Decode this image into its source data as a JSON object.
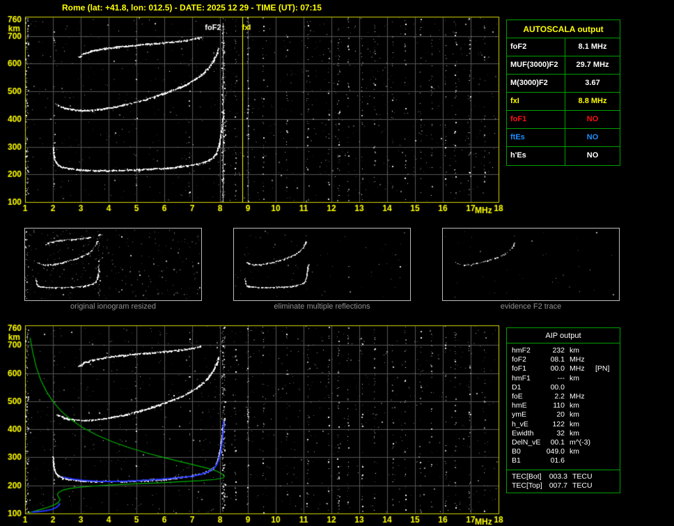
{
  "title": "Rome (lat: +41.8, lon: 012.5) - DATE: 2025 12 29 - TIME (UT): 07:15",
  "colors": {
    "background": "#000000",
    "axis_text": "#ffff00",
    "plot_border": "#d6d600",
    "grid": "#565656",
    "table_border": "#00a000",
    "fof2_marker": "#e8e8e8",
    "fxi_marker": "#ffff00",
    "profile_green": "#00b400",
    "profile_blue": "#2233ff",
    "caption_gray": "#919191",
    "red": "#ff1010",
    "blue": "#1e8fff",
    "yellow": "#ffff00",
    "white": "#ffffff"
  },
  "ionogram": {
    "type": "scatter",
    "x_range": [
      1,
      18
    ],
    "y_range": [
      100,
      770
    ],
    "x_ticks": [
      1,
      2,
      3,
      4,
      5,
      6,
      7,
      8,
      9,
      10,
      11,
      12,
      13,
      14,
      15,
      16,
      17,
      18
    ],
    "y_ticks": [
      760,
      700,
      600,
      500,
      400,
      300,
      200,
      100
    ],
    "x_unit": "MHz",
    "y_unit": "km"
  },
  "top_plot": {
    "foF2_label": "foF2",
    "fxI_label": "fxI",
    "foF2_freq": 8.1,
    "fxI_freq": 8.8
  },
  "traces": {
    "first_hop": [
      [
        2.0,
        302
      ],
      [
        2.02,
        278
      ],
      [
        2.05,
        258
      ],
      [
        2.1,
        244
      ],
      [
        2.2,
        233
      ],
      [
        2.35,
        226
      ],
      [
        2.6,
        221
      ],
      [
        3.0,
        217
      ],
      [
        3.5,
        214
      ],
      [
        4.0,
        214
      ],
      [
        4.5,
        215
      ],
      [
        5.0,
        217
      ],
      [
        5.5,
        219
      ],
      [
        6.0,
        222
      ],
      [
        6.4,
        226
      ],
      [
        6.8,
        231
      ],
      [
        7.1,
        236
      ],
      [
        7.4,
        243
      ],
      [
        7.6,
        251
      ],
      [
        7.75,
        261
      ],
      [
        7.85,
        273
      ],
      [
        7.92,
        289
      ],
      [
        7.97,
        309
      ],
      [
        8.02,
        336
      ],
      [
        8.06,
        366
      ],
      [
        8.1,
        400
      ],
      [
        8.13,
        432
      ]
    ],
    "second_hop": [
      [
        2.15,
        452
      ],
      [
        2.3,
        444
      ],
      [
        2.5,
        438
      ],
      [
        2.8,
        433
      ],
      [
        3.1,
        431
      ],
      [
        3.4,
        432
      ],
      [
        3.8,
        437
      ],
      [
        4.2,
        444
      ],
      [
        4.6,
        452
      ],
      [
        5.0,
        462
      ],
      [
        5.4,
        473
      ],
      [
        5.8,
        486
      ],
      [
        6.2,
        500
      ],
      [
        6.6,
        516
      ],
      [
        6.9,
        531
      ],
      [
        7.15,
        547
      ],
      [
        7.4,
        566
      ],
      [
        7.6,
        587
      ],
      [
        7.75,
        609
      ],
      [
        7.87,
        633
      ],
      [
        7.95,
        657
      ]
    ],
    "third_hop": [
      [
        2.9,
        622
      ],
      [
        3.1,
        636
      ],
      [
        3.4,
        646
      ],
      [
        3.8,
        654
      ],
      [
        4.3,
        661
      ],
      [
        4.8,
        666
      ],
      [
        5.4,
        671
      ],
      [
        6.0,
        676
      ],
      [
        6.5,
        681
      ],
      [
        7.0,
        688
      ],
      [
        7.3,
        695
      ]
    ]
  },
  "profiles": {
    "density_profile": [
      [
        1.18,
        726
      ],
      [
        1.28,
        672
      ],
      [
        1.4,
        622
      ],
      [
        1.56,
        576
      ],
      [
        1.77,
        534
      ],
      [
        2.02,
        496
      ],
      [
        2.32,
        462
      ],
      [
        2.68,
        432
      ],
      [
        3.1,
        404
      ],
      [
        3.6,
        378
      ],
      [
        4.15,
        355
      ],
      [
        4.75,
        334
      ],
      [
        5.35,
        316
      ],
      [
        5.95,
        300
      ],
      [
        6.55,
        285
      ],
      [
        7.1,
        272
      ],
      [
        7.55,
        261
      ],
      [
        7.9,
        250
      ],
      [
        8.08,
        240
      ],
      [
        8.16,
        232
      ],
      [
        8.1,
        226
      ],
      [
        7.8,
        221
      ],
      [
        7.3,
        217
      ],
      [
        6.6,
        213
      ],
      [
        5.8,
        209
      ],
      [
        5.0,
        206
      ],
      [
        4.2,
        202
      ],
      [
        3.5,
        198
      ],
      [
        3.0,
        194
      ],
      [
        2.6,
        189
      ],
      [
        2.35,
        183
      ],
      [
        2.22,
        176
      ],
      [
        2.16,
        168
      ],
      [
        2.2,
        158
      ],
      [
        2.26,
        150
      ],
      [
        2.22,
        142
      ],
      [
        2.08,
        132
      ],
      [
        1.85,
        123
      ],
      [
        1.55,
        114
      ],
      [
        1.3,
        107
      ],
      [
        1.15,
        102
      ]
    ],
    "restored_trace": [
      [
        2.35,
        230
      ],
      [
        2.7,
        223
      ],
      [
        3.1,
        218
      ],
      [
        3.6,
        215
      ],
      [
        4.1,
        214
      ],
      [
        4.6,
        215
      ],
      [
        5.1,
        217
      ],
      [
        5.6,
        220
      ],
      [
        6.1,
        224
      ],
      [
        6.6,
        228
      ],
      [
        7.0,
        233
      ],
      [
        7.3,
        239
      ],
      [
        7.55,
        247
      ],
      [
        7.73,
        257
      ],
      [
        7.86,
        270
      ],
      [
        7.94,
        287
      ],
      [
        8.0,
        307
      ],
      [
        8.05,
        333
      ],
      [
        8.09,
        363
      ],
      [
        8.12,
        398
      ],
      [
        8.14,
        430
      ]
    ],
    "e_region": [
      [
        1.25,
        105
      ],
      [
        1.5,
        107
      ],
      [
        1.75,
        110
      ],
      [
        1.95,
        114
      ],
      [
        2.1,
        120
      ],
      [
        2.2,
        128
      ],
      [
        2.26,
        136
      ]
    ]
  },
  "autoscala_table": {
    "header": "AUTOSCALA output",
    "rows": [
      {
        "label": "foF2",
        "value": "8.1 MHz",
        "color": "#ffffff"
      },
      {
        "label": "MUF(3000)F2",
        "value": "29.7 MHz",
        "color": "#ffffff"
      },
      {
        "label": "M(3000)F2",
        "value": "3.67",
        "color": "#ffffff"
      },
      {
        "label": "fxI",
        "value": "8.8 MHz",
        "color": "#ffff00"
      },
      {
        "label": "foF1",
        "value": "NO",
        "color": "#ff1010"
      },
      {
        "label": "ftEs",
        "value": "NO",
        "color": "#1e8fff"
      },
      {
        "label": "h'Es",
        "value": "NO",
        "color": "#ffffff"
      }
    ]
  },
  "thumbnails": {
    "items": [
      {
        "caption": "original ionogram resized"
      },
      {
        "caption": "eliminate multiple reflections"
      },
      {
        "caption": "evidence F2 trace"
      }
    ]
  },
  "aip_table": {
    "header": "AIP output",
    "rows": [
      {
        "label": "hmF2",
        "value": "232",
        "unit": "km",
        "extra": ""
      },
      {
        "label": "foF2",
        "value": "08.1",
        "unit": "MHz",
        "extra": ""
      },
      {
        "label": "foF1",
        "value": "00.0",
        "unit": "MHz",
        "extra": "[PN]"
      },
      {
        "label": "hmF1",
        "value": "---",
        "unit": "km",
        "extra": ""
      },
      {
        "label": "D1",
        "value": "00.0",
        "unit": "",
        "extra": ""
      },
      {
        "label": "foE",
        "value": "2.2",
        "unit": "MHz",
        "extra": ""
      },
      {
        "label": "hmE",
        "value": "110",
        "unit": "km",
        "extra": ""
      },
      {
        "label": "ymE",
        "value": "20",
        "unit": "km",
        "extra": ""
      },
      {
        "label": "h_vE",
        "value": "122",
        "unit": "km",
        "extra": ""
      },
      {
        "label": "Ewidth",
        "value": "32",
        "unit": "km",
        "extra": ""
      },
      {
        "label": "DelN_vE",
        "value": "00.1",
        "unit": "m^(-3)",
        "extra": ""
      },
      {
        "label": "B0",
        "value": "049.0",
        "unit": "km",
        "extra": ""
      },
      {
        "label": "B1",
        "value": "01.6",
        "unit": "",
        "extra": ""
      }
    ],
    "tec_rows": [
      {
        "label": "TEC[Bot]",
        "value": "003.3",
        "unit": "TECU",
        "extra": ""
      },
      {
        "label": "TEC[Top]",
        "value": "007.7",
        "unit": "TECU",
        "extra": ""
      }
    ]
  }
}
